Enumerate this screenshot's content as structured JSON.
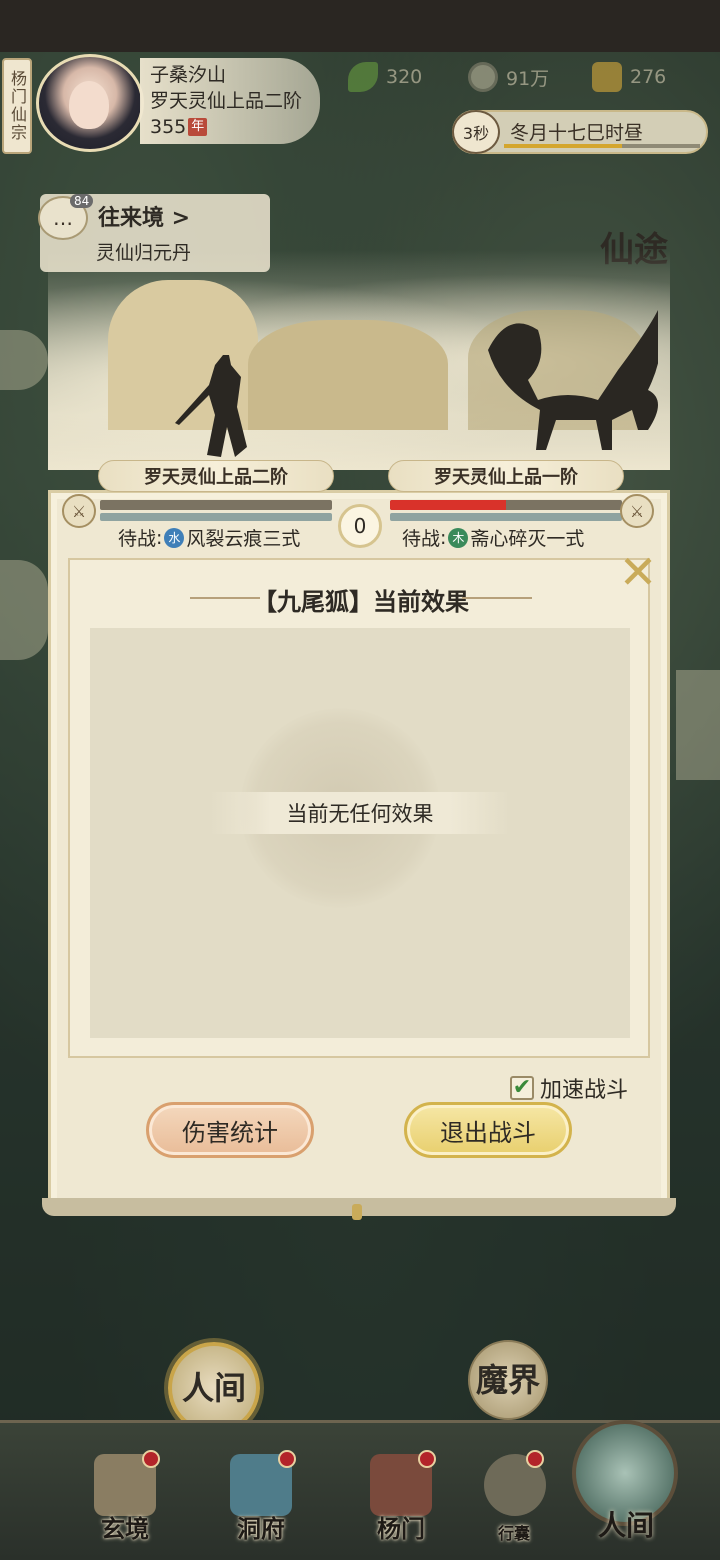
{
  "header": {
    "sect_tag": "杨门仙宗",
    "player_name": "子桑汐山",
    "player_realm": "罗天灵仙上品二阶",
    "player_age": "355",
    "age_unit": "年",
    "resources": {
      "leaf": "320",
      "coin": "91万",
      "gold": "276"
    },
    "timer": {
      "seconds": "3秒",
      "time_text": "冬月十七巳时昼"
    }
  },
  "guild": {
    "count": "84",
    "title": "往来境 >",
    "subtitle": "灵仙归元丹"
  },
  "map_label": "仙途",
  "battle": {
    "left_rank": "罗天灵仙上品二阶",
    "right_rank": "罗天灵仙上品一阶",
    "round": "0",
    "left_hp_fraction": 1.0,
    "right_hp_fraction": 0.5,
    "left_wait_prefix": "待战",
    "left_wait_element": "水",
    "left_wait_skill": "风裂云痕三式",
    "right_wait_prefix": "待战",
    "right_wait_element": "木",
    "right_wait_skill": "斋心碎灭一式"
  },
  "effects": {
    "title": "【九尾狐】当前效果",
    "empty_text": "当前无任何效果"
  },
  "controls": {
    "speed_label": "加速战斗",
    "speed_checked": true,
    "damage_button": "伤害统计",
    "exit_button": "退出战斗"
  },
  "realms": {
    "human": "人间",
    "demon": "魔界"
  },
  "nav": {
    "xuanjing": "玄境",
    "dongfu": "洞府",
    "yangmen": "杨门",
    "xingnang": "行囊",
    "renjian": "人间"
  },
  "colors": {
    "panel_bg": "#efe8d2",
    "hp_red": "#d9322a",
    "hp_gray": "#7b7362",
    "mp_teal": "#8fa3a0",
    "damage_btn": "#e9bc98",
    "exit_btn": "#e8cf6d"
  }
}
